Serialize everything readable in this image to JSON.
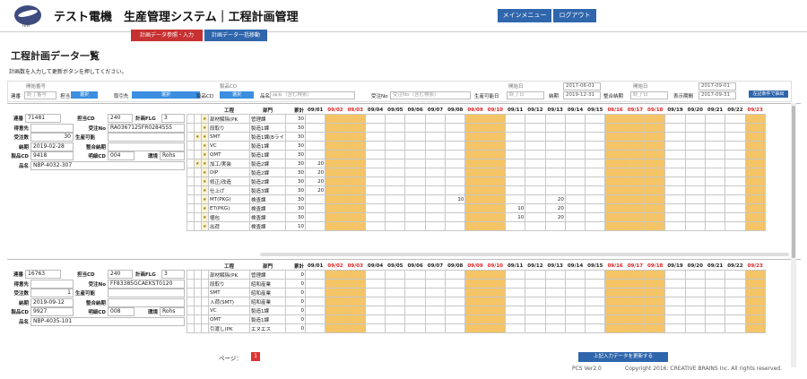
{
  "header": {
    "logo_text": "TEST",
    "title": "テスト電機　生産管理システム｜工程計画管理",
    "menu_button": "メインメニュー",
    "logout_button": "ログアウト"
  },
  "tabs": [
    {
      "label": "計画データ参照・入力",
      "color": "#c83131"
    },
    {
      "label": "計画データ一括移動",
      "color": "#2f66ac"
    }
  ],
  "page_title": "工程計画データ一覧",
  "instruction": "計画数を入力して更新ボタンを押してください。",
  "filters": {
    "order_no_label_top": "開始番号",
    "order_no_label": "連番",
    "order_no_placeholder": "終了番号",
    "person_label": "担当",
    "person_select": "選択",
    "customer_label": "取引先",
    "customer_select": "選択",
    "product_cd_label_top": "製品CD",
    "product_cd_label": "製品CD",
    "product_cd_select": "選択",
    "product_name_label": "品名",
    "product_name_placeholder": "品名（含む検索）",
    "receive_no_label": "受注No",
    "receive_no_placeholder": "受注No（含む検索）",
    "producible_label": "生産可能日",
    "producible_top": "開始日",
    "producible_placeholder": "終了日",
    "due_label": "納期",
    "due_from": "2017-06-01",
    "due_to": "2019-12-31",
    "adjusted_due_label": "整合納期",
    "adjusted_top": "開始日",
    "adjusted_placeholder": "終了日",
    "display_label": "表示期間",
    "display_from": "2017-09-01",
    "display_to": "2017-09-31",
    "extract_button": "左記条件で抽出"
  },
  "grid_headers": {
    "process": "工程",
    "dept": "部門",
    "total": "累計"
  },
  "dates": [
    {
      "d": "09/01",
      "red": false,
      "hol": false
    },
    {
      "d": "09/02",
      "red": true,
      "hol": true
    },
    {
      "d": "09/03",
      "red": true,
      "hol": true
    },
    {
      "d": "09/04",
      "red": false,
      "hol": false
    },
    {
      "d": "09/05",
      "red": false,
      "hol": false
    },
    {
      "d": "09/06",
      "red": false,
      "hol": false
    },
    {
      "d": "09/07",
      "red": false,
      "hol": false
    },
    {
      "d": "09/08",
      "red": false,
      "hol": false
    },
    {
      "d": "09/09",
      "red": true,
      "hol": true
    },
    {
      "d": "09/10",
      "red": true,
      "hol": true
    },
    {
      "d": "09/11",
      "red": false,
      "hol": false
    },
    {
      "d": "09/12",
      "red": false,
      "hol": false
    },
    {
      "d": "09/13",
      "red": false,
      "hol": false
    },
    {
      "d": "09/14",
      "red": false,
      "hol": false
    },
    {
      "d": "09/15",
      "red": false,
      "hol": false
    },
    {
      "d": "09/16",
      "red": true,
      "hol": true
    },
    {
      "d": "09/17",
      "red": true,
      "hol": true
    },
    {
      "d": "09/18",
      "red": true,
      "hol": true
    },
    {
      "d": "09/19",
      "red": false,
      "hol": false
    },
    {
      "d": "09/20",
      "red": false,
      "hol": false
    },
    {
      "d": "09/21",
      "red": false,
      "hol": false
    },
    {
      "d": "09/22",
      "red": false,
      "hol": false
    },
    {
      "d": "09/23",
      "red": true,
      "hol": true
    }
  ],
  "labels": {
    "serial": "連番",
    "person_cd": "担当CD",
    "plan_flg": "計画FLG",
    "customer": "得意先",
    "receive_no": "受注No",
    "qty": "受注数",
    "producible": "生産可能",
    "due": "納期",
    "adjusted": "整合納期",
    "product_cd": "製品CD",
    "detail_cd": "明細CD",
    "env": "環境",
    "product_name": "品名"
  },
  "orders": [
    {
      "serial": "71481",
      "person_cd": "240",
      "plan_flg": "3",
      "customer": "",
      "receive_no": "RA0367125FR0284555",
      "qty": "30",
      "producible": "",
      "due": "2019-02-28",
      "adjusted": "",
      "product_cd": "9418",
      "detail_cd": "004",
      "env": "Rohs",
      "product_name": "NBP-4032-307",
      "processes": [
        {
          "name": "部材解除(PK",
          "dept": "管理課",
          "total": "30",
          "star": true,
          "check": false,
          "vals": {}
        },
        {
          "name": "段取り",
          "dept": "製造1課",
          "total": "30",
          "star": true,
          "check": false,
          "vals": {}
        },
        {
          "name": "SMT",
          "dept": "製造1課(Bライ",
          "total": "30",
          "star": true,
          "check": true,
          "vals": {}
        },
        {
          "name": "VC",
          "dept": "製造1課",
          "total": "30",
          "star": true,
          "check": false,
          "vals": {}
        },
        {
          "name": "QMT",
          "dept": "製造1課",
          "total": "30",
          "star": true,
          "check": false,
          "vals": {}
        },
        {
          "name": "加工/実装",
          "dept": "製造2課",
          "total": "30",
          "star": true,
          "check": true,
          "vals": {
            "09/01": "20"
          }
        },
        {
          "name": "DIP",
          "dept": "製造2課",
          "total": "30",
          "star": true,
          "check": false,
          "vals": {
            "09/01": "20"
          }
        },
        {
          "name": "修正/改造",
          "dept": "製造2課",
          "total": "30",
          "star": true,
          "check": false,
          "vals": {
            "09/01": "20"
          }
        },
        {
          "name": "仕上げ",
          "dept": "製造3課",
          "total": "30",
          "star": true,
          "check": false,
          "vals": {
            "09/01": "20"
          }
        },
        {
          "name": "MT(PKG)",
          "dept": "検査課",
          "total": "30",
          "star": true,
          "check": false,
          "vals": {
            "09/08": "10",
            "09/13": "20"
          }
        },
        {
          "name": "ET(PKG)",
          "dept": "検査課",
          "total": "30",
          "star": true,
          "check": false,
          "vals": {
            "09/11": "10",
            "09/13": "20"
          }
        },
        {
          "name": "梱包",
          "dept": "検査課",
          "total": "30",
          "star": true,
          "check": false,
          "vals": {
            "09/11": "10",
            "09/13": "20"
          }
        },
        {
          "name": "出荷",
          "dept": "検査課",
          "total": "10",
          "star": true,
          "check": false,
          "vals": {}
        }
      ]
    },
    {
      "serial": "16763",
      "person_cd": "240",
      "plan_flg": "3",
      "customer": "",
      "receive_no": "FF83385GCAEKST0120",
      "qty": "1",
      "producible": "",
      "due": "2019-09-12",
      "adjusted": "",
      "product_cd": "9927",
      "detail_cd": "008",
      "env": "Rohs",
      "product_name": "NBP-4035-101",
      "processes": [
        {
          "name": "部材解除(PK",
          "dept": "管理課",
          "total": "0",
          "star": false,
          "check": false,
          "vals": {}
        },
        {
          "name": "段取り",
          "dept": "昭和産業",
          "total": "0",
          "star": false,
          "check": false,
          "vals": {}
        },
        {
          "name": "SMT",
          "dept": "昭和産業",
          "total": "0",
          "star": false,
          "check": false,
          "vals": {}
        },
        {
          "name": "入荷(SMT)",
          "dept": "昭和産業",
          "total": "0",
          "star": false,
          "check": false,
          "vals": {}
        },
        {
          "name": "VC",
          "dept": "製造1課",
          "total": "0",
          "star": false,
          "check": false,
          "vals": {}
        },
        {
          "name": "QMT",
          "dept": "製造1課",
          "total": "0",
          "star": false,
          "check": false,
          "vals": {}
        },
        {
          "name": "引渡し(PK",
          "dept": "エヌエス",
          "total": "0",
          "star": false,
          "check": false,
          "vals": {}
        }
      ]
    }
  ],
  "footer": {
    "page_label": "ページ：",
    "page_num": "1",
    "update_button": "上記入力データを更新する",
    "version": "PCS Ver2.0",
    "copyright": "Copyright 2016: CREATIVE BRAINS Inc. All rights reserved."
  }
}
